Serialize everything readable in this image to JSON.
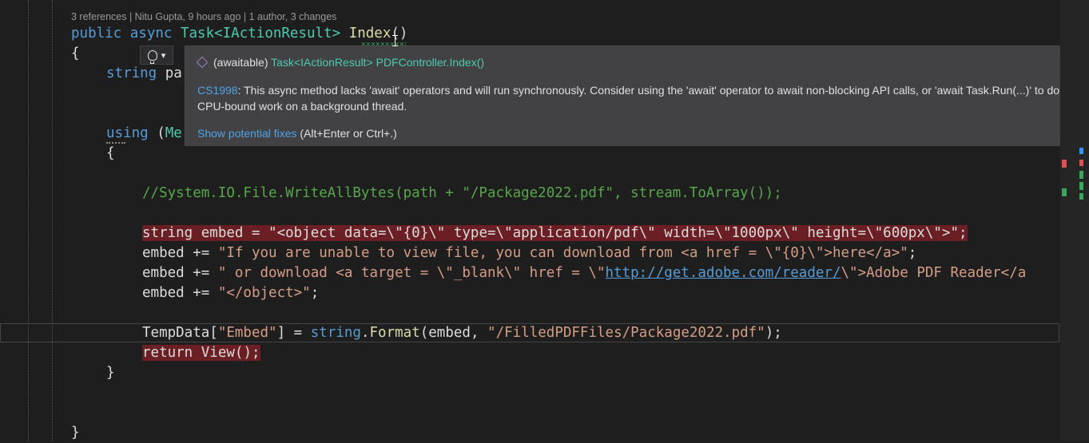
{
  "codelens": "3 references | Nitu Gupta, 9 hours ago | 1 author, 3 changes",
  "code": {
    "l1_kw": "public async ",
    "l1_type": "Task<IActionResult>",
    "l1_sp": " ",
    "l1_fn": "Index",
    "l1_paren": "()",
    "brace_open": "{",
    "l2_kw": "string",
    "l2_rest": " pa",
    "l3_kw": "using",
    "l3_rest": " (",
    "l3_type": "Me",
    "inner_open": "{",
    "comment": "//System.IO.File.WriteAllBytes(path + \"/Package2022.pdf\", stream.ToArray());",
    "embed1_kw": "string",
    "embed1_mid": " embed = ",
    "embed1_str": "\"<object data=\\\"{0}\\\" type=\\\"application/pdf\\\" width=\\\"1000px\\\" height=\\\"600px\\\">\"",
    "embed1_end": ";",
    "embed2_lead": "embed += ",
    "embed2_str": "\"If you are unable to view file, you can download from <a href = \\\"{0}\\\">here</a>\"",
    "embed2_end": ";",
    "embed3_lead": "embed += ",
    "embed3_str": "\" or download <a target = \\\"_blank\\\" href = \\\"",
    "embed3_link": "http://get.adobe.com/reader/",
    "embed3_tail": "\\\">Adobe PDF Reader</a",
    "embed4_lead": "embed += ",
    "embed4_str": "\"</object>\"",
    "embed4_end": ";",
    "tempdata_lead": "TempData[",
    "tempdata_key": "\"Embed\"",
    "tempdata_mid": "] = ",
    "tempdata_kw": "string",
    "tempdata_dot": ".",
    "tempdata_fn": "Format",
    "tempdata_args": "(embed, ",
    "tempdata_path": "\"/FilledPDFFiles/Package2022.pdf\"",
    "tempdata_end": ");",
    "return_kw": "return",
    "return_sp": " ",
    "return_fn": "View",
    "return_end": "();",
    "inner_close": "}",
    "brace_close": "}"
  },
  "tooltip": {
    "sig_prefix": "(awaitable) ",
    "sig_type": "Task<IActionResult>",
    "sig_sp": " ",
    "sig_member": "PDFController.Index()",
    "error_code": "CS1998",
    "message_line1": ": This async method lacks 'await' operators and will run synchronously. Consider using the 'await' operator to await non-blocking API calls, or 'await Task.Run(...)' to do",
    "message_line2": "CPU-bound work on a background thread.",
    "fix_link": "Show potential fixes",
    "fix_shortcut": " (Alt+Enter or Ctrl+.)"
  },
  "colors": {
    "keyword": "#569cd6",
    "type": "#4ec9b0",
    "method": "#dcdcaa",
    "string": "#d69d85",
    "comment": "#57a64a",
    "error_highlight": "#6b1f25",
    "tooltip_bg": "#424245",
    "link": "#4fa3e6"
  },
  "icons": [
    "lightbulb-icon",
    "chevron-down-icon",
    "cube-icon",
    "text-cursor-icon"
  ]
}
